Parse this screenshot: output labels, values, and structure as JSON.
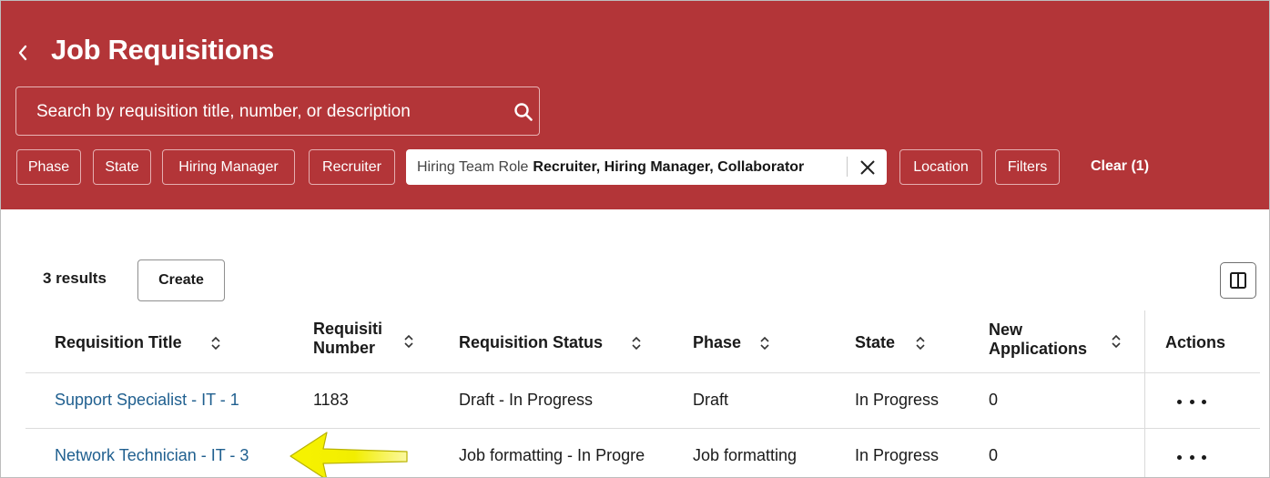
{
  "page": {
    "title": "Job Requisitions",
    "back_icon": "chevron-left-icon"
  },
  "search": {
    "placeholder": "Search by requisition title, number, or description",
    "icon": "search-icon"
  },
  "filters": {
    "chips": [
      "Phase",
      "State",
      "Hiring Manager",
      "Recruiter"
    ],
    "active_chip": {
      "label": "Hiring Team Role",
      "value": "Recruiter, Hiring Manager, Collaborator",
      "remove_icon": "close-icon"
    },
    "chips_after": [
      "Location",
      "Filters"
    ],
    "clear_label": "Clear (1)"
  },
  "toolbar": {
    "results_label": "3 results",
    "create_label": "Create",
    "columns_icon": "column-layout-icon"
  },
  "table": {
    "headers": {
      "title": "Requisition Title",
      "number_line1": "Requisiti",
      "number_line2": "Number",
      "status": "Requisition Status",
      "phase": "Phase",
      "state": "State",
      "new_apps_line1": "New",
      "new_apps_line2": "Applications",
      "actions": "Actions"
    },
    "rows": [
      {
        "title": "Support Specialist - IT - 1",
        "number": "1183",
        "status": "Draft - In Progress",
        "phase": "Draft",
        "state": "In Progress",
        "new_applications": "0"
      },
      {
        "title": "Network Technician - IT - 3",
        "number": "",
        "status": "Job formatting - In Progre",
        "phase": "Job formatting",
        "state": "In Progress",
        "new_applications": "0"
      }
    ]
  },
  "annotation": {
    "arrow_icon": "yellow-pointer-arrow",
    "arrow_color": "#f2ee00"
  },
  "colors": {
    "header_bg": "#b33538",
    "link": "#1f5f8f"
  }
}
